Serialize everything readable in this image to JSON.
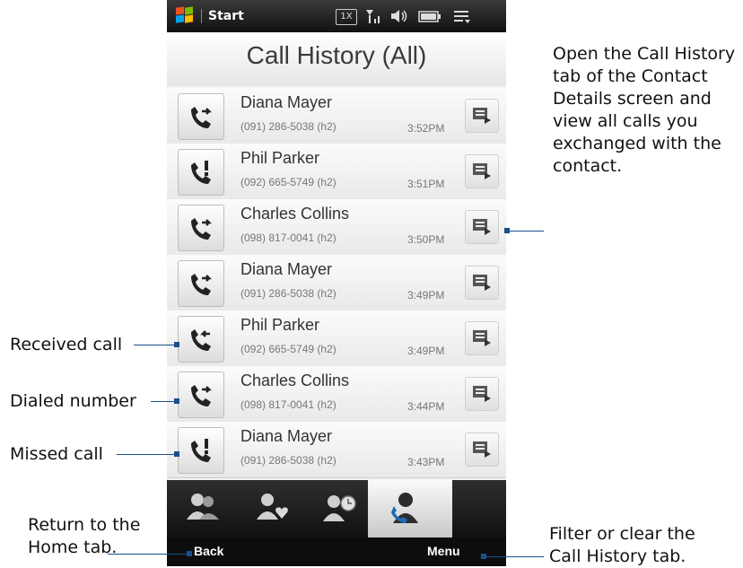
{
  "statusbar": {
    "start_label": "Start",
    "icons": [
      "network-1x-icon",
      "signal-icon",
      "speaker-icon",
      "battery-icon",
      "menu-icon"
    ],
    "network_label": "1X"
  },
  "header": {
    "title": "Call History (All)"
  },
  "calls": [
    {
      "name": "Diana Mayer",
      "number": "(091) 286-5038 (h2)",
      "time": "3:52PM",
      "type": "dialed"
    },
    {
      "name": "Phil Parker",
      "number": "(092) 665-5749 (h2)",
      "time": "3:51PM",
      "type": "missed"
    },
    {
      "name": "Charles Collins",
      "number": "(098) 817-0041 (h2)",
      "time": "3:50PM",
      "type": "dialed"
    },
    {
      "name": "Diana Mayer",
      "number": "(091) 286-5038 (h2)",
      "time": "3:49PM",
      "type": "dialed"
    },
    {
      "name": "Phil Parker",
      "number": "(092) 665-5749 (h2)",
      "time": "3:49PM",
      "type": "received"
    },
    {
      "name": "Charles Collins",
      "number": "(098) 817-0041 (h2)",
      "time": "3:44PM",
      "type": "dialed"
    },
    {
      "name": "Diana Mayer",
      "number": "(091) 286-5038 (h2)",
      "time": "3:43PM",
      "type": "missed"
    }
  ],
  "tabs": [
    {
      "icon": "all-people-icon",
      "active": false
    },
    {
      "icon": "favorites-people-icon",
      "active": false
    },
    {
      "icon": "updates-people-icon",
      "active": false
    },
    {
      "icon": "call-history-icon",
      "active": true
    }
  ],
  "softkeys": {
    "left": "Back",
    "right": "Menu"
  },
  "callouts": {
    "detail": [
      "Open the Call History",
      "tab of the Contact",
      "Details screen and",
      "view all calls you",
      "exchanged with the",
      "contact."
    ],
    "received": "Received call",
    "dialed": "Dialed number",
    "missed": "Missed call",
    "back": [
      "Return to the",
      "Home tab."
    ],
    "menu": [
      "Filter or clear the",
      "Call History tab."
    ]
  },
  "colors": {
    "callout_line": "#1a4f8c",
    "phone_bg": "#1b1b1b",
    "windows_logo": [
      "#f25022",
      "#7fba00",
      "#00a4ef",
      "#ffb900"
    ]
  }
}
